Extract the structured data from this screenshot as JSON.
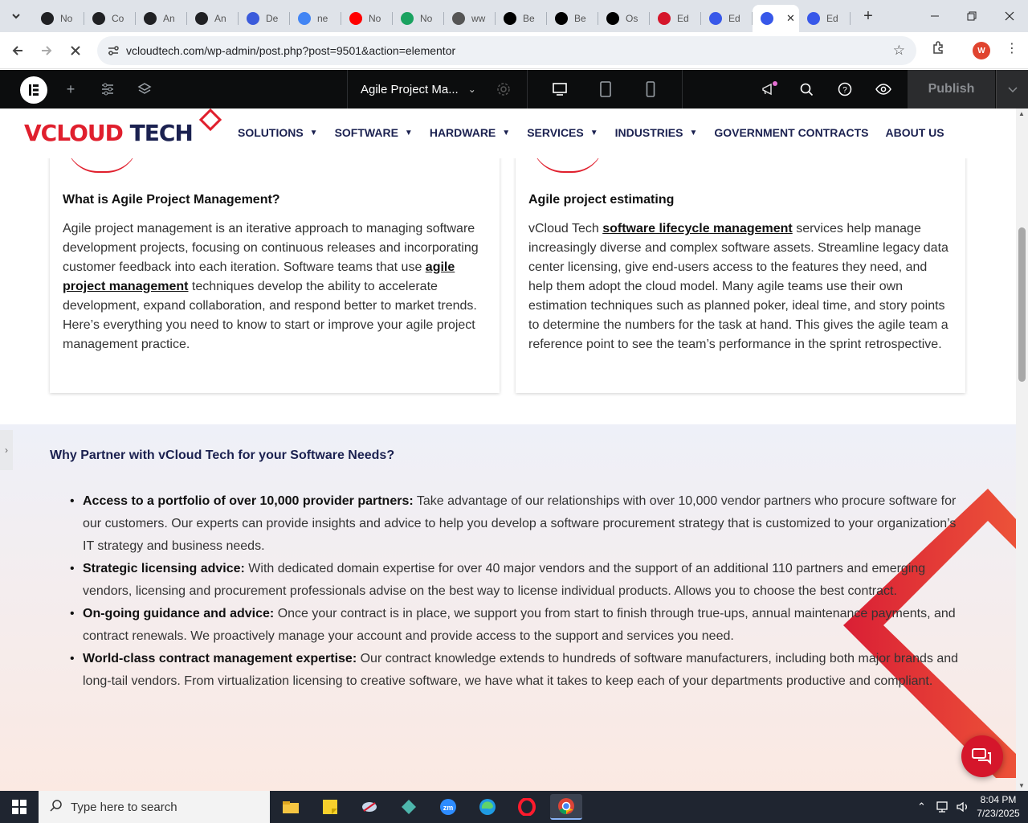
{
  "browser": {
    "tabs": [
      {
        "label": "No",
        "icon": "openai-icon",
        "color": "#202124"
      },
      {
        "label": "Co",
        "icon": "openai-icon",
        "color": "#202124"
      },
      {
        "label": "An",
        "icon": "openai-icon",
        "color": "#202124"
      },
      {
        "label": "An",
        "icon": "openai-icon",
        "color": "#202124"
      },
      {
        "label": "De",
        "icon": "deepl-icon",
        "color": "#3b5bdb"
      },
      {
        "label": "ne",
        "icon": "google-icon",
        "color": "#4285f4"
      },
      {
        "label": "No",
        "icon": "youtube-icon",
        "color": "#ff0000"
      },
      {
        "label": "No",
        "icon": "wordtune-icon",
        "color": "#1aa260"
      },
      {
        "label": "ww",
        "icon": "linkedin-icon",
        "color": "#555555"
      },
      {
        "label": "Be",
        "icon": "x-icon",
        "color": "#000000"
      },
      {
        "label": "Be",
        "icon": "x-icon",
        "color": "#000000"
      },
      {
        "label": "Os",
        "icon": "notion-icon",
        "color": "#000000"
      },
      {
        "label": "Ed",
        "icon": "elementor-icon",
        "color": "#d5162b"
      },
      {
        "label": "Ed",
        "icon": "wordpress-icon",
        "color": "#3858e9"
      },
      {
        "label": "",
        "icon": "wordpress-icon",
        "color": "#3858e9"
      },
      {
        "label": "Ed",
        "icon": "wordpress-icon",
        "color": "#3858e9"
      }
    ],
    "active_tab_index": 14,
    "close_glyph": "✕",
    "new_tab_glyph": "+",
    "url": "vcloudtech.com/wp-admin/post.php?post=9501&action=elementor",
    "profile_initial": "W"
  },
  "elementor": {
    "logo": "E",
    "document_title": "Agile Project Ma...",
    "publish_label": "Publish"
  },
  "site": {
    "brand_part1": "VCLOUD",
    "brand_part2": " TECH",
    "menu": [
      {
        "label": "SOLUTIONS",
        "dropdown": true
      },
      {
        "label": "SOFTWARE",
        "dropdown": true
      },
      {
        "label": "HARDWARE",
        "dropdown": true
      },
      {
        "label": "SERVICES",
        "dropdown": true
      },
      {
        "label": "INDUSTRIES",
        "dropdown": true
      },
      {
        "label": "GOVERNMENT CONTRACTS",
        "dropdown": false
      },
      {
        "label": "ABOUT US",
        "dropdown": false
      }
    ]
  },
  "cards": [
    {
      "title": "What is Agile Project Management?",
      "text_before": "Agile project management is an iterative approach to managing software development projects, focusing on continuous releases and incorporating customer feedback into each iteration. Software teams that use ",
      "link": "agile project management",
      "text_after": " techniques develop the ability to accelerate development, expand collaboration, and respond better to market trends. Here’s everything you need to know to start or improve your agile project management practice."
    },
    {
      "title": "Agile project estimating",
      "text_before": "vCloud Tech ",
      "link": "software lifecycle management",
      "text_after": " services help manage increasingly diverse and complex software assets. Streamline legacy data center licensing, give end-users access to the features they need, and help them adopt the cloud model. Many agile teams use their own estimation techniques such as planned poker, ideal time, and story points to determine the numbers for the task at hand. This gives the agile team a reference point to see the team’s performance in the sprint retrospective."
    }
  ],
  "partner": {
    "heading": "Why Partner with vCloud Tech for your Software Needs?",
    "items": [
      {
        "lead": "Access to a portfolio of over 10,000 provider partners:",
        "text": " Take advantage of our relationships with over 10,000 vendor partners who procure software for our customers. Our experts can provide insights and advice to help you develop a software procurement strategy that is customized to your organization’s IT strategy and business needs."
      },
      {
        "lead": "Strategic licensing advice:",
        "text": " With dedicated domain expertise for over 40 major vendors and the support of an additional 110 partners and emerging vendors, licensing and procurement professionals advise on the best way to license individual products. Allows you to choose the best contract."
      },
      {
        "lead": "On-going guidance and advice:",
        "text": " Once your contract is in place, we support you from start to finish through true-ups, annual maintenance payments, and contract renewals. We proactively manage your account and provide access to the support and services you need."
      },
      {
        "lead": "World-class contract management expertise:",
        "text": " Our contract knowledge extends to hundreds of software manufacturers, including both major brands and long-tail vendors. From virtualization licensing to creative software, we have what it takes to keep each of your departments productive and compliant."
      }
    ]
  },
  "taskbar": {
    "search_placeholder": "Type here to search",
    "time": "8:04 PM",
    "date": "7/23/2025"
  },
  "colors": {
    "brand_red": "#e01f2d",
    "brand_navy": "#1b2150",
    "elementor_bar": "#0c0d0e"
  }
}
